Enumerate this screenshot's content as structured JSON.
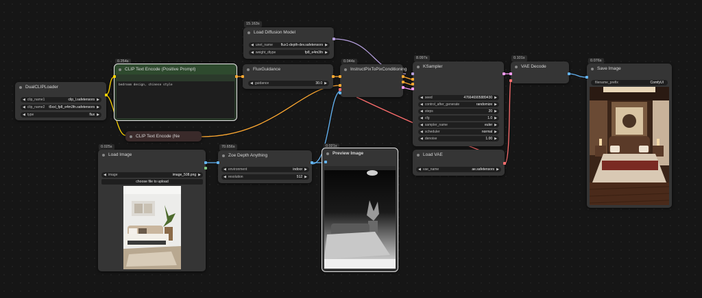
{
  "nodes": {
    "dualclip": {
      "title": "DualCLIPLoader",
      "clip_name1_label": "clip_name1",
      "clip_name1": "clip_l.safetensors",
      "clip_name2_label": "clip_name2",
      "clip_name2": "t5xxl_fp8_e4m3fn.safetensors",
      "type_label": "type",
      "type": "flux"
    },
    "load_diffusion": {
      "timing": "15.163s",
      "title": "Load Diffusion Model",
      "unet_name_label": "unet_name",
      "unet_name": "flux1-depth-dev.safetensors",
      "weight_dtype_label": "weight_dtype",
      "weight_dtype": "fp8_e4m3fn"
    },
    "clip_pos": {
      "timing": "0.254s",
      "title": "CLIP Text Encode (Positive Prompt)",
      "text": "bedroom design, chinese style"
    },
    "clip_neg": {
      "title": "CLIP Text Encode (Ne"
    },
    "flux_guidance": {
      "title": "FluxGuidance",
      "guidance_label": "guidance",
      "guidance": "30.0"
    },
    "instruct": {
      "timing": "0.044s",
      "title": "InstructPixToPixConditioning"
    },
    "ksampler": {
      "timing": "8.097s",
      "title": "KSampler",
      "seed_label": "seed",
      "seed": "476646905889430",
      "control_label": "control_after_generate",
      "control": "randomize",
      "steps_label": "steps",
      "steps": "20",
      "cfg_label": "cfg",
      "cfg": "1.0",
      "sampler_label": "sampler_name",
      "sampler": "euler",
      "scheduler_label": "scheduler",
      "scheduler": "normal",
      "denoise_label": "denoise",
      "denoise": "1.00"
    },
    "vae_decode": {
      "timing": "0.101s",
      "title": "VAE Decode"
    },
    "save_image": {
      "timing": "0.076s",
      "title": "Save Image",
      "prefix_label": "filename_prefix",
      "prefix": "ComfyUI"
    },
    "load_image": {
      "timing": "0.025s",
      "title": "Load Image",
      "image_label": "image",
      "image": "image_508.png",
      "upload": "choose file to upload"
    },
    "zoe": {
      "timing": "70.656s",
      "title": "Zoe Depth Anything",
      "env_label": "environment",
      "env": "indoor",
      "res_label": "resolution",
      "res": "512"
    },
    "preview": {
      "timing": "0.021s",
      "title": "Preview Image"
    },
    "load_vae": {
      "title": "Load VAE",
      "vae_label": "vae_name",
      "vae": "ae.safetensors"
    }
  },
  "colors": {
    "model": "#b39ddb",
    "clip": "#ffd500",
    "conditioning": "#ffa931",
    "latent": "#ff9cf9",
    "image": "#64b5f6",
    "vae": "#ff6e6e",
    "pos_prompt_bg": "#2e4a2e"
  }
}
